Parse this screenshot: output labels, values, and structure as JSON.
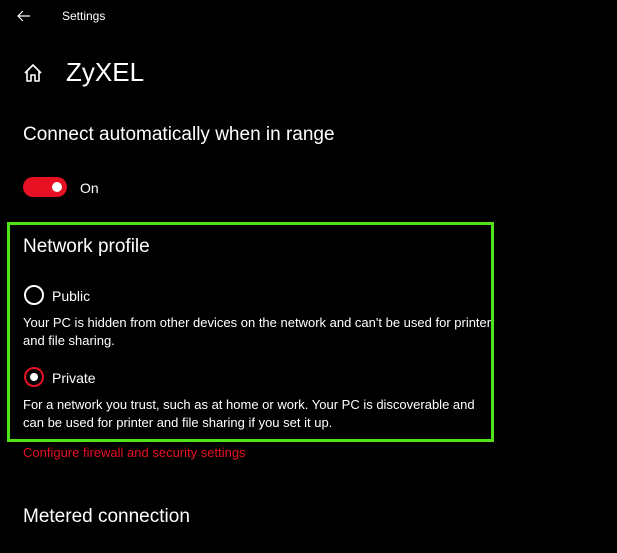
{
  "titlebar": {
    "title": "Settings",
    "back_icon": "back-arrow-icon"
  },
  "header": {
    "home_icon": "home-icon",
    "title": "ZyXEL"
  },
  "connect_auto": {
    "heading": "Connect automatically when in range",
    "toggle_state": "On",
    "toggle_on": true
  },
  "network_profile": {
    "heading": "Network profile",
    "options": [
      {
        "label": "Public",
        "selected": false,
        "description": "Your PC is hidden from other devices on the network and can't be used for printer and file sharing."
      },
      {
        "label": "Private",
        "selected": true,
        "description": "For a network you trust, such as at home or work. Your PC is discoverable and can be used for printer and file sharing if you set it up."
      }
    ]
  },
  "firewall_link": "Configure firewall and security settings",
  "metered": {
    "heading": "Metered connection"
  },
  "colors": {
    "background": "#000000",
    "accent": "#e81123",
    "highlight": "#52e41a",
    "text": "#ffffff"
  }
}
